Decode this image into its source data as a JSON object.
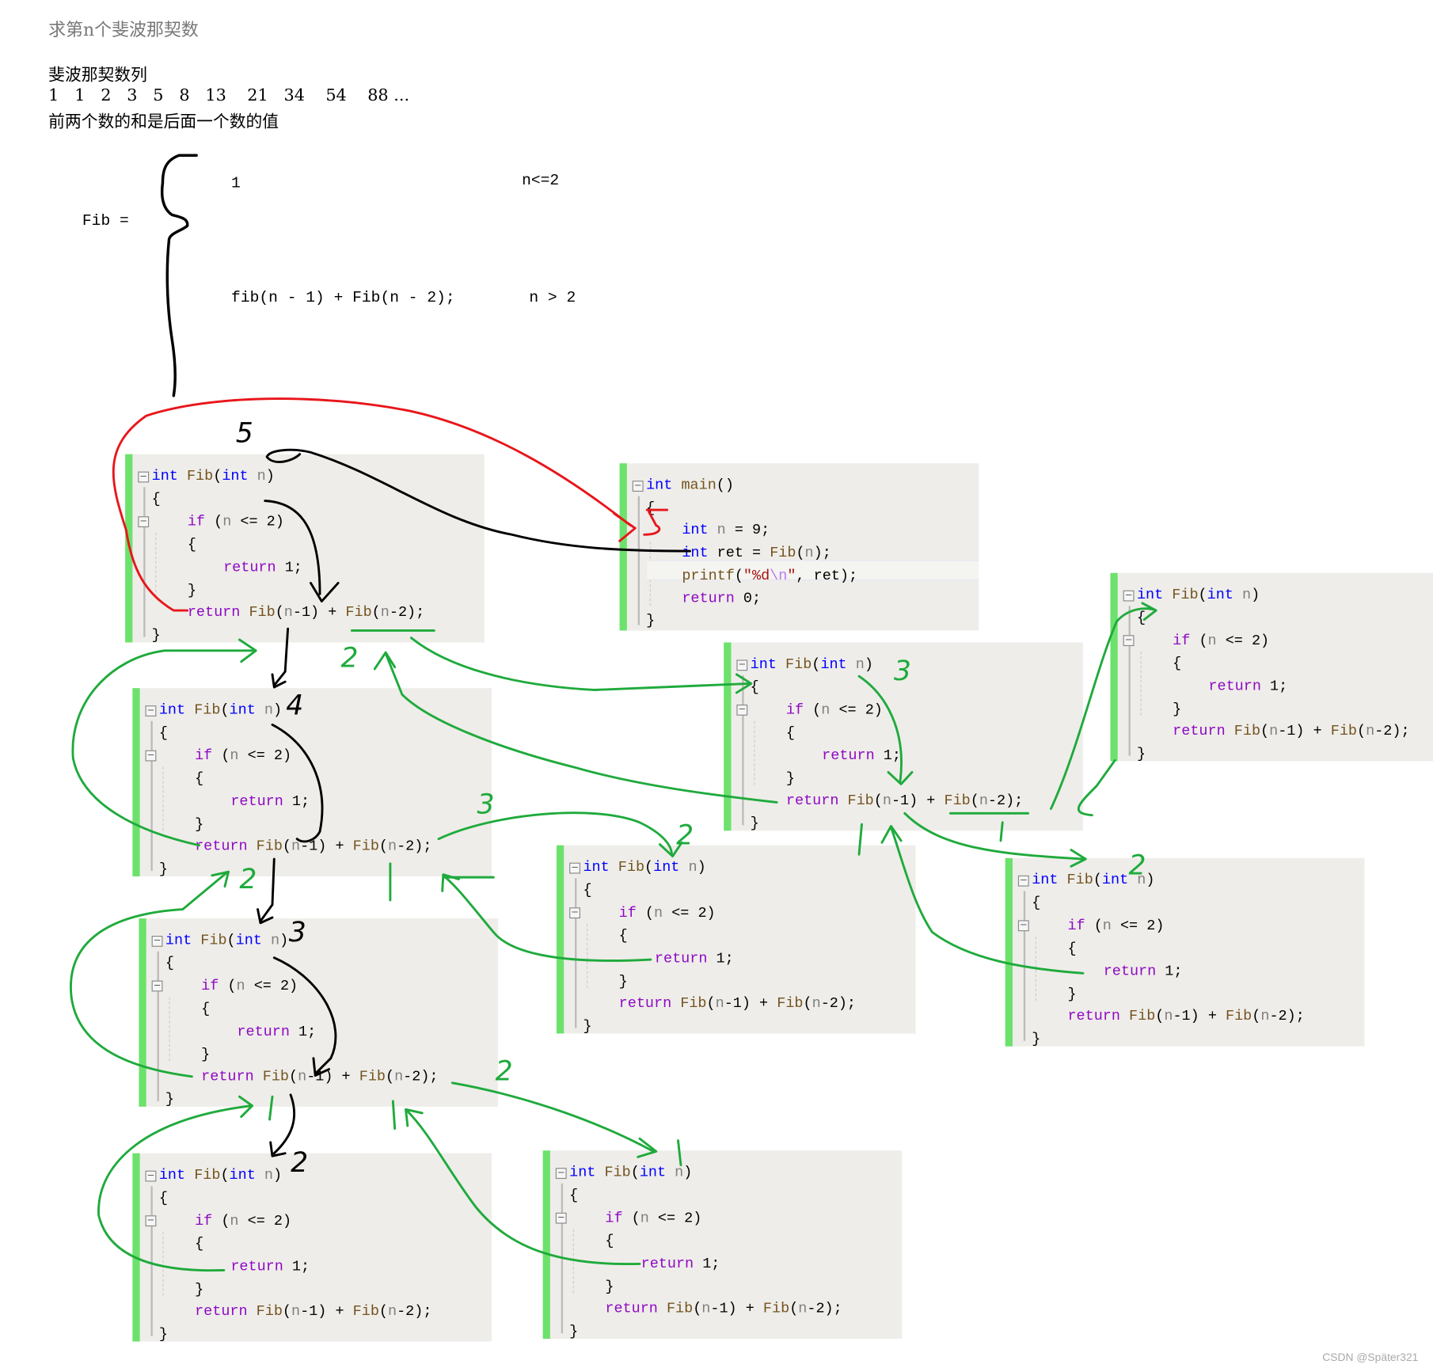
{
  "header": {
    "title": "求第n个斐波那契数",
    "subtitle": "斐波那契数列",
    "sequence": "1   1   2   3   5   8   13    21   34    54    88 ...",
    "rule": "前两个数的和是后面一个数的值"
  },
  "formula": {
    "lhs": "Fib =",
    "case1_value": "1",
    "case1_cond": "n<=2",
    "case2_value": "fib(n - 1) + Fib(n - 2);",
    "case2_cond": "n > 2"
  },
  "code": {
    "fib_lines": [
      "int Fib(int n)",
      "{",
      "    if (n <= 2)",
      "    {",
      "        return 1;",
      "    }",
      "    return Fib(n-1) + Fib(n-2);",
      "}"
    ],
    "main_lines": [
      "int main()",
      "{",
      "    int n = 9;",
      "    int ret = Fib(n);",
      "    printf(\"%d\\n\", ret);",
      "    return 0;",
      "}"
    ]
  },
  "annotations": {
    "colors": {
      "red": "#e8161b",
      "black": "#000000",
      "green": "#1faa3c"
    },
    "digits": {
      "five_black": "5",
      "four": "4",
      "three_black": "3",
      "two_black": "2",
      "three_green_a": "3",
      "two_green_a": "2",
      "three_green_b": "3",
      "two_green_b": "2",
      "two_green_c": "2",
      "two_green_d": "2",
      "two_green_e": "2"
    }
  },
  "watermark": "CSDN @Später321"
}
